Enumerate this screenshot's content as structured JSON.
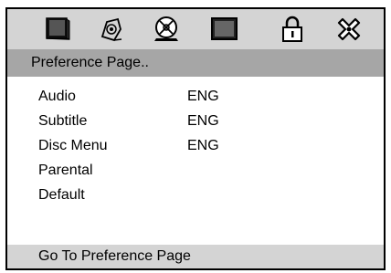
{
  "toolbar": {
    "icons": [
      {
        "name": "tv-screen-icon"
      },
      {
        "name": "audio-speaker-icon"
      },
      {
        "name": "disc-icon"
      },
      {
        "name": "video-screen-icon"
      },
      {
        "name": "lock-icon"
      },
      {
        "name": "settings-icon"
      }
    ]
  },
  "title": "Preference Page..",
  "menu": {
    "items": [
      {
        "label": "Audio",
        "value": "ENG"
      },
      {
        "label": "Subtitle",
        "value": "ENG"
      },
      {
        "label": "Disc Menu",
        "value": "ENG"
      },
      {
        "label": "Parental",
        "value": ""
      },
      {
        "label": "Default",
        "value": ""
      }
    ]
  },
  "status": "Go To Preference Page",
  "colors": {
    "toolbar_bg": "#d4d4d4",
    "title_bg": "#a6a6a6",
    "status_bg": "#d4d4d4",
    "frame": "#000000"
  }
}
